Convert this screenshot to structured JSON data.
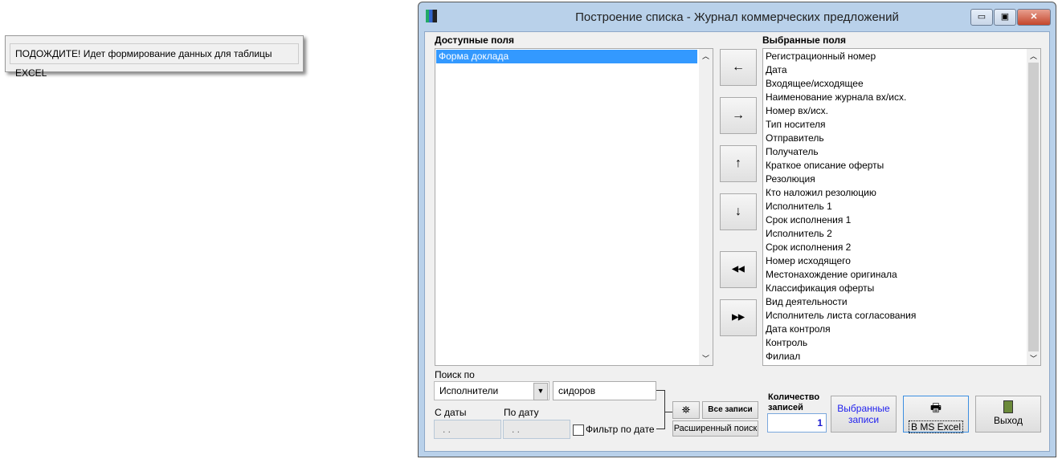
{
  "wait_popup": {
    "text": "ПОДОЖДИТЕ! Идет формирование данных для таблицы EXCEL"
  },
  "window": {
    "title": "Построение списка - Журнал коммерческих предложений",
    "minimize": "▭",
    "maximize": "▣",
    "close": "✕"
  },
  "available": {
    "label": "Доступные поля",
    "items": [
      "Форма доклада"
    ]
  },
  "selected": {
    "label": "Выбранные поля",
    "items": [
      "Регистрационный номер",
      "Дата",
      "Входящее/исходящее",
      "Наименование журнала вх/исх.",
      "Номер вх/исх.",
      "Тип носителя",
      "Отправитель",
      "Получатель",
      "Краткое описание оферты",
      "Резолюция",
      "Кто наложил резолюцию",
      "Исполнитель 1",
      "Срок исполнения 1",
      "Исполнитель 2",
      "Срок исполнения 2",
      "Номер исходящего",
      "Местонахождение оригинала",
      "Классификация оферты",
      "Вид деятельности",
      "Исполнитель листа согласования",
      "Дата контроля",
      "Контроль",
      "Филиал"
    ]
  },
  "arrows": {
    "left": "←",
    "right": "→",
    "up": "↑",
    "down": "↓",
    "all_left": "◀◀",
    "all_right": "▶▶"
  },
  "search": {
    "label": "Поиск по",
    "field": "Исполнители",
    "value": "сидоров",
    "from_label": "С даты",
    "to_label": "По дату",
    "from_value": ". .",
    "to_value": ". .",
    "filter_label": "Фильтр по дате",
    "all_records": "Все записи",
    "advanced": "Расширенный поиск"
  },
  "count": {
    "label": "Количество записей",
    "value": "1"
  },
  "buttons": {
    "selected_records": "Выбранные записи",
    "excel": "В MS Excel",
    "exit": "Выход"
  }
}
